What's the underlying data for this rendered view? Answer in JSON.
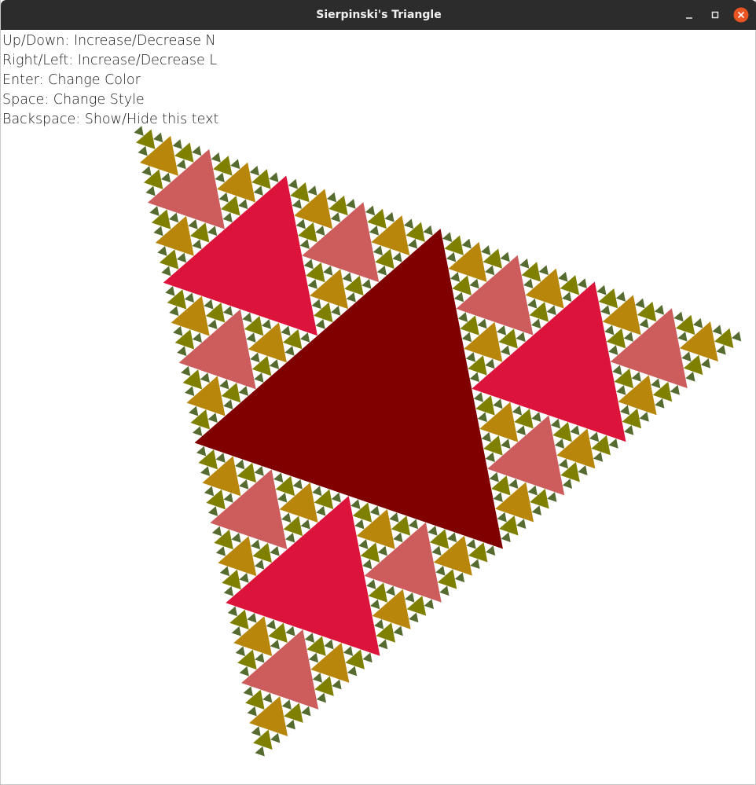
{
  "window": {
    "title": "Sierpinski's Triangle",
    "titlebar_color": "#2c2c2c",
    "close_color": "#e95420"
  },
  "help_lines": [
    "Up/Down: Increase/Decrease N",
    "Right/Left: Increase/Decrease L",
    "Enter: Change Color",
    "Space: Change Style",
    "Backspace: Show/Hide this text"
  ],
  "fractal": {
    "depth": 6,
    "level_colors": [
      "#800000",
      "#dc143c",
      "#cd5c5c",
      "#b8860b",
      "#808000",
      "#556b2f"
    ],
    "background": "#ffffff"
  }
}
